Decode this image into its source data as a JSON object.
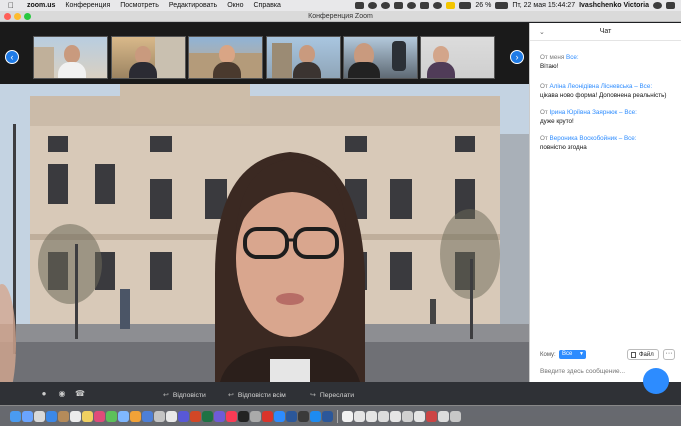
{
  "menubar": {
    "app": "zoom.us",
    "items": [
      "Конференция",
      "Посмотреть",
      "Редактировать",
      "Окно",
      "Справка"
    ],
    "battery": "26 %",
    "datetime": "Пт, 22 мая  15:44:27",
    "user": "Ivashchenko Victoria"
  },
  "window": {
    "title": "Конференция Zoom"
  },
  "chat": {
    "header": "Чат",
    "messages": [
      {
        "from_prefix": "От ",
        "from_name": "меня",
        "to": " Все:",
        "text": "Вітаю!"
      },
      {
        "from_prefix": "От ",
        "from_name": "Аліна Леонідівна Лісневська",
        "to": " – Все:",
        "text": "цікава ново форма! Доповнена реальність)"
      },
      {
        "from_prefix": "От ",
        "from_name": "Ірина Юріївна Заярнюк",
        "to": " – Все:",
        "text": "дуже круто!"
      },
      {
        "from_prefix": "От ",
        "from_name": "Вероника Воскобойник",
        "to": " – Все:",
        "text": "повністю згодна"
      }
    ],
    "to_label": "Кому:",
    "to_value": "Все",
    "file_button": "Файл",
    "more_button": "···",
    "input_placeholder": "Введите здесь сообщение..."
  },
  "toolbar": {
    "reply": "Відповісти",
    "reply_all": "Відповісти всім",
    "forward": "Переслати"
  },
  "colors": {
    "accent": "#2d8cff",
    "chat_name": "#2d8cff"
  }
}
